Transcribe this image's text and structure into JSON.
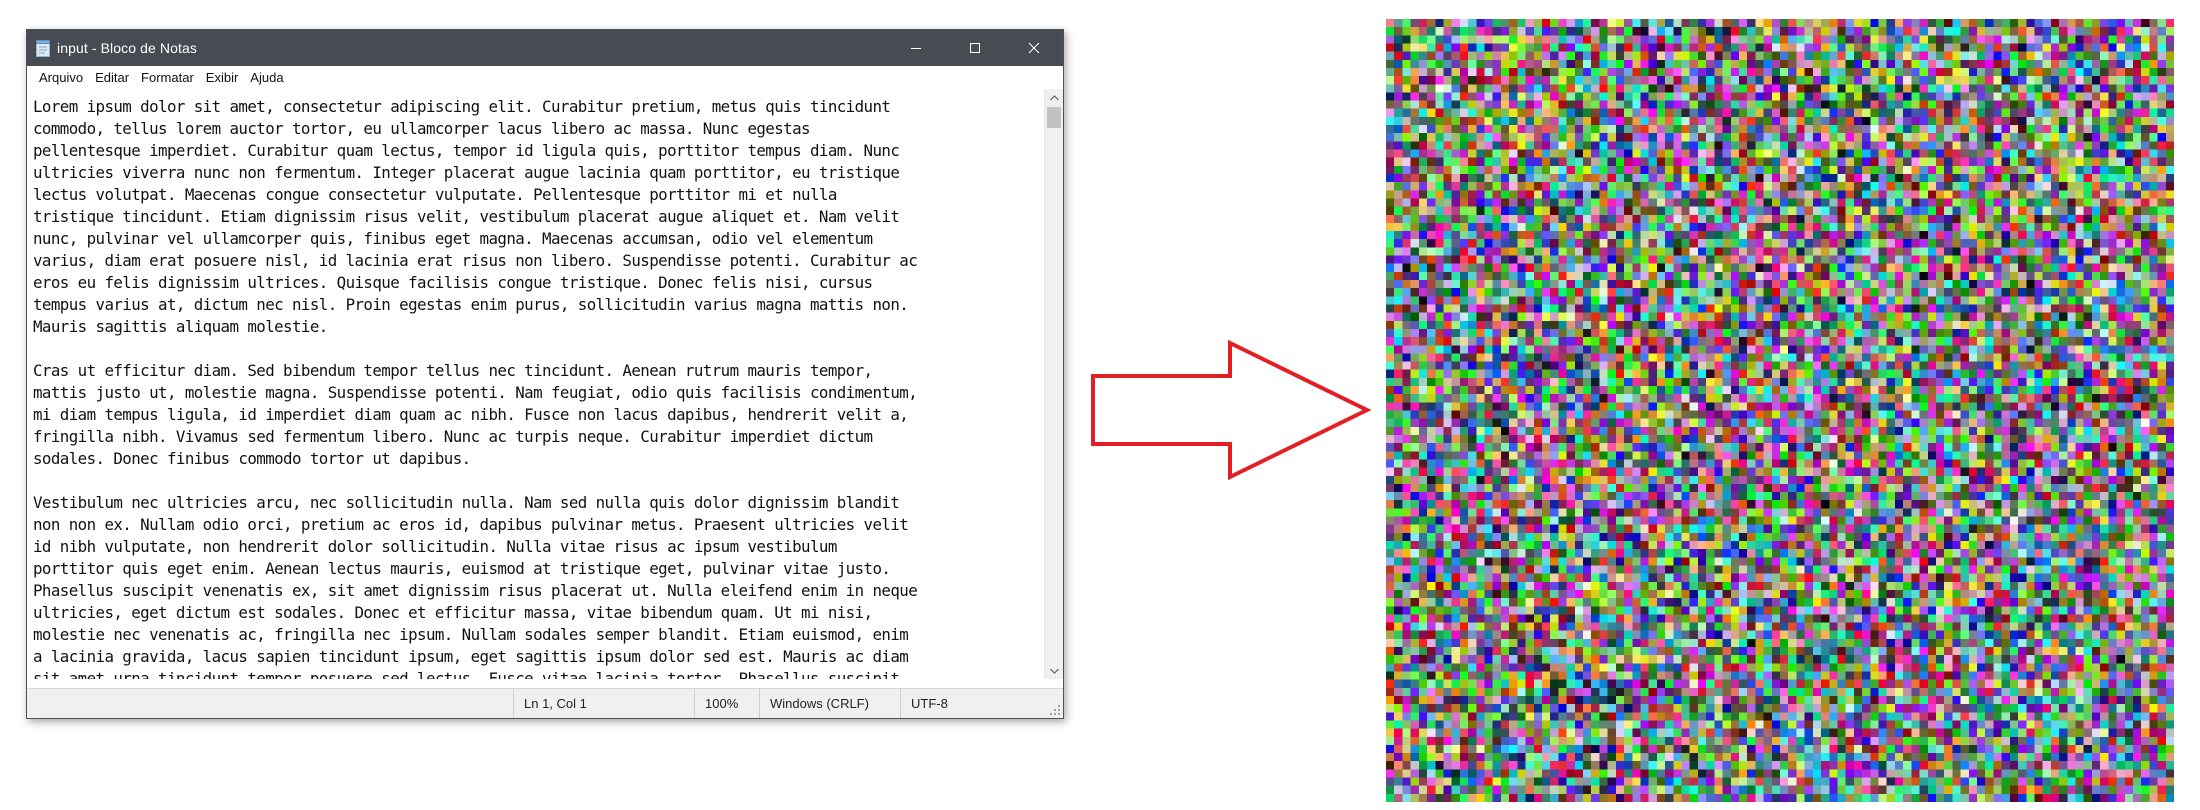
{
  "window": {
    "title": "input - Bloco de Notas",
    "icon": "notepad-icon",
    "caption_icons": [
      "minimize-icon",
      "maximize-icon",
      "close-icon"
    ]
  },
  "menu": {
    "items": [
      "Arquivo",
      "Editar",
      "Formatar",
      "Exibir",
      "Ajuda"
    ]
  },
  "editor": {
    "text": "Lorem ipsum dolor sit amet, consectetur adipiscing elit. Curabitur pretium, metus quis tincidunt\ncommodo, tellus lorem auctor tortor, eu ullamcorper lacus libero ac massa. Nunc egestas\npellentesque imperdiet. Curabitur quam lectus, tempor id ligula quis, porttitor tempus diam. Nunc\nultricies viverra nunc non fermentum. Integer placerat augue lacinia quam porttitor, eu tristique\nlectus volutpat. Maecenas congue consectetur vulputate. Pellentesque porttitor mi et nulla\ntristique tincidunt. Etiam dignissim risus velit, vestibulum placerat augue aliquet et. Nam velit\nnunc, pulvinar vel ullamcorper quis, finibus eget magna. Maecenas accumsan, odio vel elementum\nvarius, diam erat posuere nisl, id lacinia erat risus non libero. Suspendisse potenti. Curabitur ac\neros eu felis dignissim ultrices. Quisque facilisis congue tristique. Donec felis nisi, cursus\ntempus varius at, dictum nec nisl. Proin egestas enim purus, sollicitudin varius magna mattis non.\nMauris sagittis aliquam molestie.\n\nCras ut efficitur diam. Sed bibendum tempor tellus nec tincidunt. Aenean rutrum mauris tempor,\nmattis justo ut, molestie magna. Suspendisse potenti. Nam feugiat, odio quis facilisis condimentum,\nmi diam tempus ligula, id imperdiet diam quam ac nibh. Fusce non lacus dapibus, hendrerit velit a,\nfringilla nibh. Vivamus sed fermentum libero. Nunc ac turpis neque. Curabitur imperdiet dictum\nsodales. Donec finibus commodo tortor ut dapibus.\n\nVestibulum nec ultricies arcu, nec sollicitudin nulla. Nam sed nulla quis dolor dignissim blandit\nnon non ex. Nullam odio orci, pretium ac eros id, dapibus pulvinar metus. Praesent ultricies velit\nid nibh vulputate, non hendrerit dolor sollicitudin. Nulla vitae risus ac ipsum vestibulum\nporttitor quis eget enim. Aenean lectus mauris, euismod at tristique eget, pulvinar vitae justo.\nPhasellus suscipit venenatis ex, sit amet dignissim risus placerat ut. Nulla eleifend enim in neque\nultricies, eget dictum est sodales. Donec et efficitur massa, vitae bibendum quam. Ut mi nisi,\nmolestie nec venenatis ac, fringilla nec ipsum. Nullam sodales semper blandit. Etiam euismod, enim\na lacinia gravida, lacus sapien tincidunt ipsum, eget sagittis ipsum dolor sed est. Mauris ac diam\nsit amet urna tincidunt tempor posuere sed lectus. Fusce vitae lacinia tortor. Phasellus suscipit"
  },
  "status": {
    "position": "Ln 1, Col 1",
    "zoom": "100%",
    "line_ending": "Windows (CRLF)",
    "encoding": "UTF-8"
  },
  "arrow": {
    "direction": "right",
    "stroke_color": "#e31e24",
    "fill_color": "#ffffff"
  },
  "noise_image": {
    "description_icon": "random-color-pixel-grid",
    "grid_cells": 96,
    "palette_hint": "random RGB"
  }
}
